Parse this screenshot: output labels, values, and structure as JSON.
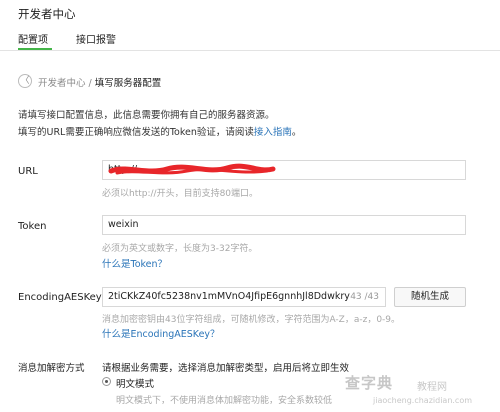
{
  "header": {
    "title": "开发者中心"
  },
  "tabs": [
    {
      "label": "配置项"
    },
    {
      "label": "接口报警"
    }
  ],
  "breadcrumb": {
    "back": "〈",
    "parent": "开发者中心",
    "separator": "/",
    "current": "填写服务器配置"
  },
  "intro": {
    "line1": "请填写接口配置信息，此信息需要你拥有自己的服务器资源。",
    "line2_prefix": "填写的URL需要正确响应微信发送的Token验证，请阅读",
    "line2_link": "接入指南",
    "line2_suffix": "。"
  },
  "url": {
    "label": "URL",
    "value": "http://",
    "hint": "必须以http://开头，目前支持80端口。"
  },
  "token": {
    "label": "Token",
    "value": "weixin",
    "hint": "必须为英文或数字，长度为3-32字符。",
    "link": "什么是Token？"
  },
  "aes": {
    "label": "EncodingAESKey",
    "value": "2tiCKkZ40fc5238nv1mMVnO4JfipE6gnnhJl8Ddwkry",
    "counter": "43 /43",
    "button": "随机生成",
    "hint": "消息加密密钥由43位字符组成，可随机修改，字符范围为A-Z，a-z，0-9。",
    "link": "什么是EncodingAESKey？"
  },
  "encrypt": {
    "label": "消息加解密方式",
    "desc": "请根据业务需要，选择消息加解密类型，启用后将立即生效",
    "option1": "明文模式",
    "option1_hint": "明文模式下，不使用消息体加解密功能，安全系数较低"
  },
  "colors": {
    "accent": "#44b549",
    "link": "#2a74b8",
    "redaction": "#e8262a"
  },
  "watermark": {
    "brand": "查字典",
    "sub": "教程网",
    "url": "jiaocheng.chazidian.com"
  }
}
